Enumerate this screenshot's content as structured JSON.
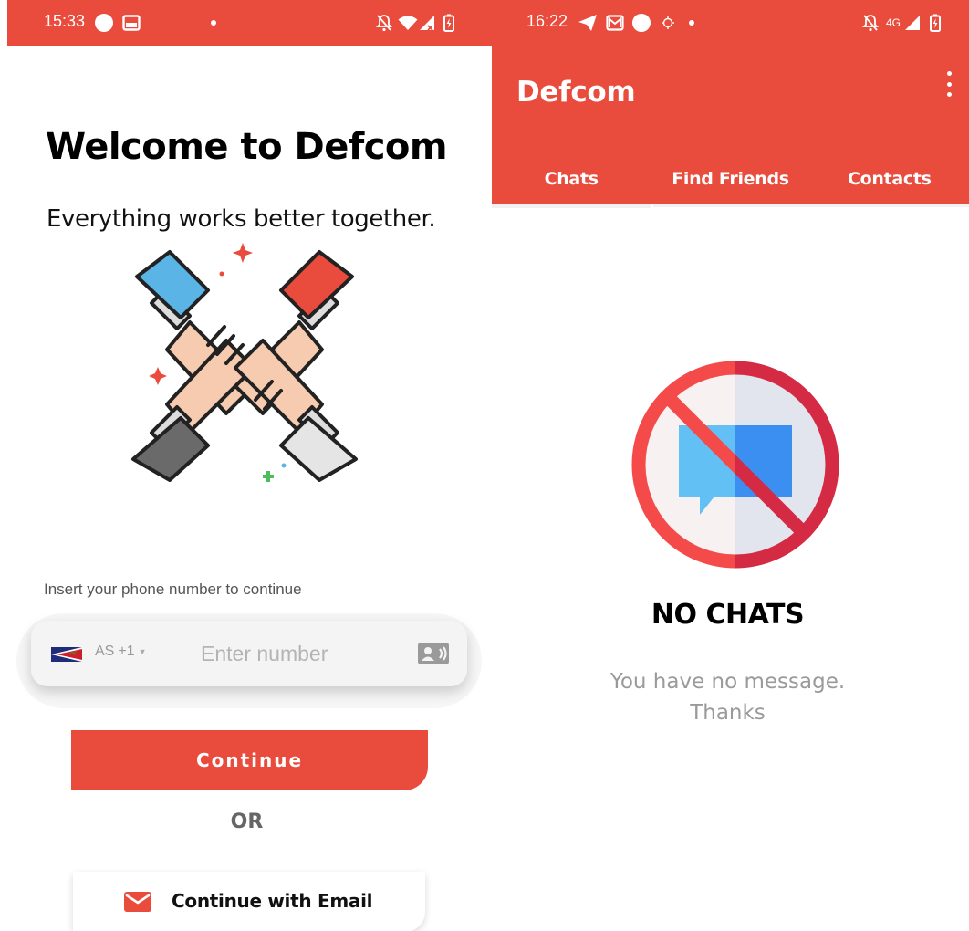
{
  "left_screen": {
    "status_bar": {
      "time": "15:33"
    },
    "welcome_title": "Welcome to Defcom",
    "welcome_subtitle": "Everything works better together.",
    "phone_label": "Insert your phone number to continue",
    "country_code": "AS",
    "dial_code": "+1",
    "phone_placeholder": "Enter number",
    "continue_label": "Continue",
    "or_label": "OR",
    "email_button_label": "Continue with Email"
  },
  "right_screen": {
    "status_bar": {
      "time": "16:22",
      "network": "4G"
    },
    "app_title": "Defcom",
    "tabs": [
      {
        "label": "Chats",
        "active": true
      },
      {
        "label": "Find Friends",
        "active": false
      },
      {
        "label": "Contacts",
        "active": false
      }
    ],
    "empty_title": "NO CHATS",
    "empty_message_line1": "You have no message.",
    "empty_message_line2": "Thanks"
  },
  "colors": {
    "brand": "#e94b3c",
    "no_entry_ring": "#f44a4a",
    "chat_bubble_light": "#63c0f5",
    "chat_bubble_dark": "#3a8ff0"
  },
  "icons": [
    "circle-dot-icon",
    "image-icon",
    "bell-off-icon",
    "wifi-icon",
    "signal-icon",
    "battery-icon",
    "send-icon",
    "gmail-icon",
    "target-icon",
    "contact-card-icon",
    "mail-icon",
    "more-vert-icon",
    "no-chat-icon"
  ]
}
